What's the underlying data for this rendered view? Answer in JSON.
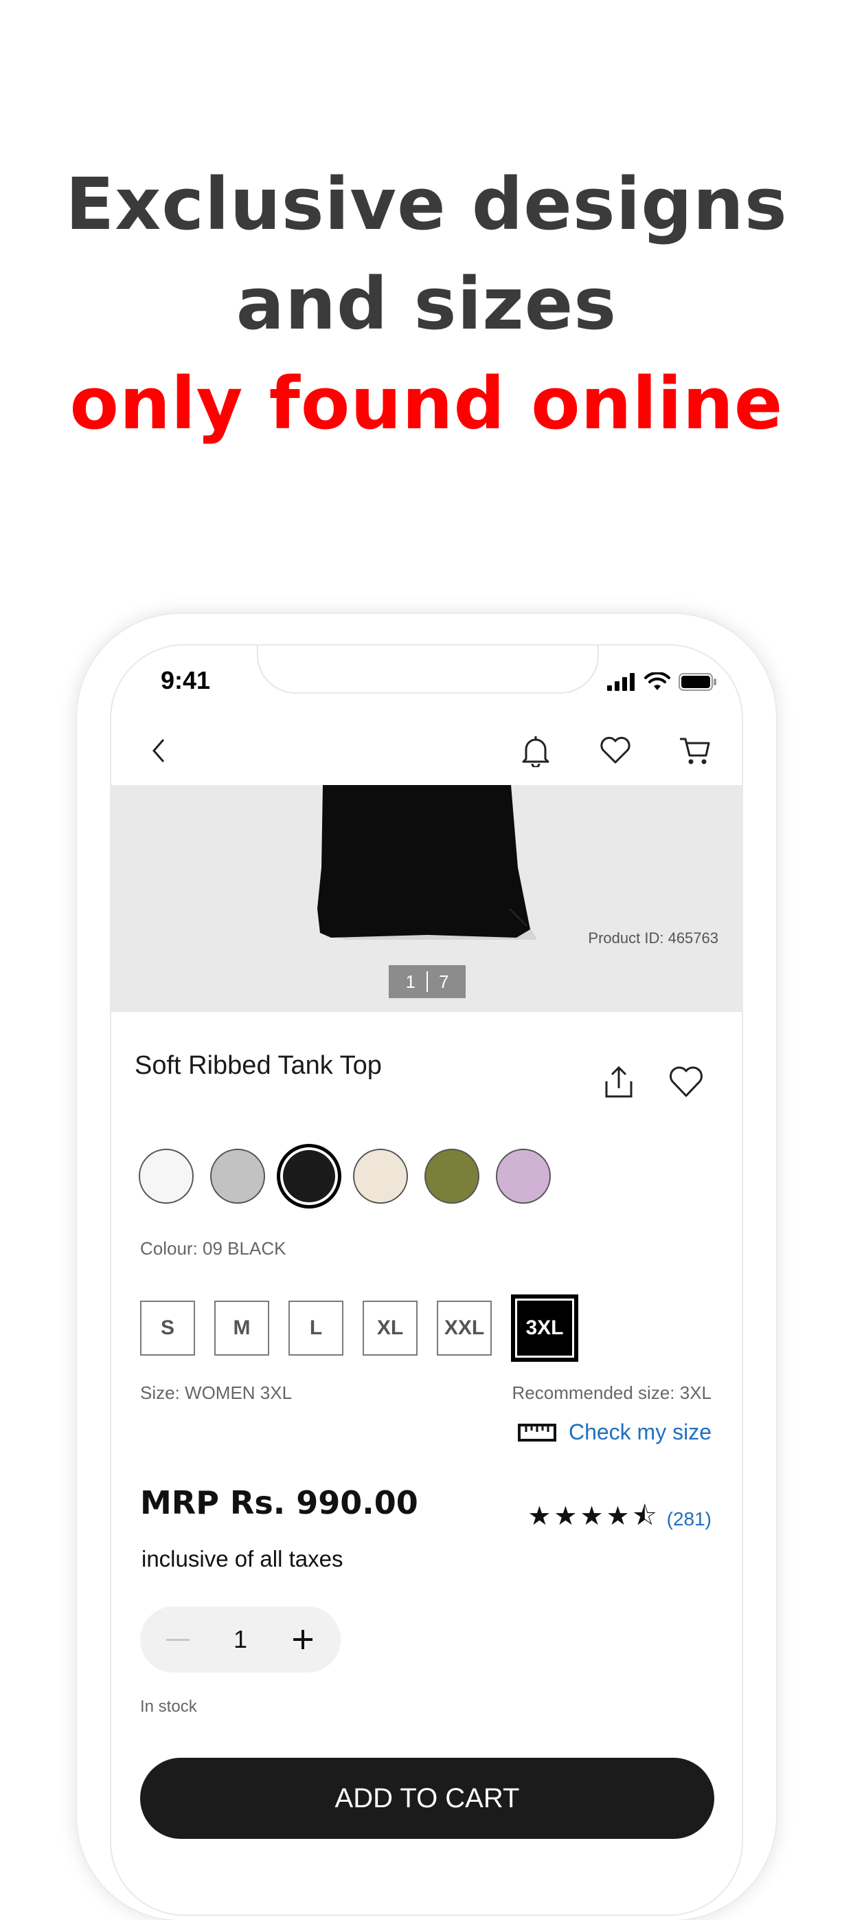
{
  "headline": {
    "line1": "Exclusive designs",
    "line2": "and sizes",
    "line3": "only found online"
  },
  "status_bar": {
    "time": "9:41"
  },
  "nav": {
    "icons": [
      "back-chevron-icon",
      "bell-icon",
      "heart-icon",
      "cart-icon"
    ]
  },
  "gallery": {
    "product_id": "Product ID: 465763",
    "page_current": "1",
    "page_total": "7"
  },
  "product": {
    "title": "Soft Ribbed Tank Top",
    "colours": [
      {
        "hex": "#f6f6f6",
        "selected": false
      },
      {
        "hex": "#c2c2c2",
        "selected": false
      },
      {
        "hex": "#1a1a1a",
        "selected": true
      },
      {
        "hex": "#efe6d8",
        "selected": false
      },
      {
        "hex": "#7c7f3a",
        "selected": false
      },
      {
        "hex": "#d0b3d4",
        "selected": false
      }
    ],
    "colour_label": "Colour: 09 BLACK",
    "sizes": [
      "S",
      "M",
      "L",
      "XL",
      "XXL",
      "3XL"
    ],
    "selected_size": "3XL",
    "size_label": "Size: WOMEN 3XL",
    "recommended_size": "Recommended size: 3XL",
    "check_size": "Check my size",
    "price": "MRP Rs. 990.00",
    "rating": 4.5,
    "rating_stars": "★★★★⯪",
    "rating_count": "(281)",
    "tax_note": "inclusive of all taxes",
    "quantity": "1",
    "stock": "In stock",
    "add_to_cart": "ADD TO CART"
  },
  "colors": {
    "accent_red": "#ff0000",
    "headline_gray": "#3b3b3b",
    "link_blue": "#1f6fbf",
    "button_black": "#1b1b1b"
  }
}
